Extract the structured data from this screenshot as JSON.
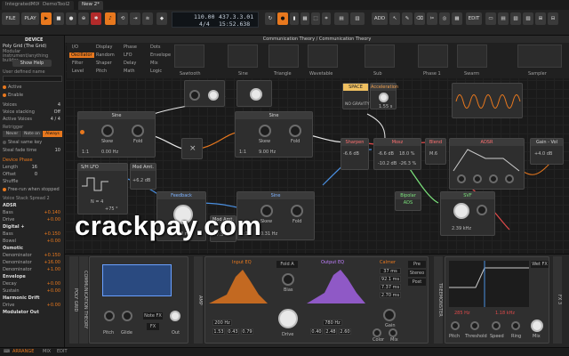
{
  "app": {
    "name": "Integrated MIX"
  },
  "tabs": [
    {
      "label": "IntegratedMIX"
    },
    {
      "label": "DemoTool2"
    },
    {
      "label": "New 2*"
    }
  ],
  "toolbar": {
    "file": "FILE",
    "play": "PLAY",
    "add": "ADD",
    "edit": "EDIT"
  },
  "transport": {
    "tempo": "110.00",
    "signature": "4/4",
    "position": "437.3.3.01",
    "time": "15:52.638"
  },
  "device": {
    "header": "DEVICE",
    "name": "Poly Grid (The Grid)",
    "description": "Modular instrument/anything builder",
    "show_help": "Show Help",
    "user_label": "User defined name",
    "active_label": "Active",
    "enable_label": "Enable",
    "voices_label": "Voices",
    "voices_value": "4",
    "voice_stacking_label": "Voice stacking",
    "voice_stacking_value": "Off",
    "active_voices_label": "Active Voices",
    "active_voices_value": "4 / 4",
    "retrigger_label": "Retrigger",
    "retrigger_opts": [
      "Never",
      "Note on",
      "Always"
    ],
    "steal_label": "Steal same key",
    "steal_fade_label": "Steal fade time",
    "steal_fade_value": "10",
    "phase_header": "Device Phase",
    "length_label": "Length",
    "length_value": "16",
    "offset_label": "Offset",
    "offset_value": "0",
    "shuffle_label": "Shuffle",
    "free_run_label": "Free-run when stopped",
    "spread_label": "Voice Stack Spread 2",
    "adsr_label": "ADSR",
    "params": [
      {
        "name": "Bass",
        "value": "+0.140"
      },
      {
        "name": "Drive",
        "value": "+0.00"
      },
      {
        "name": "Digital +",
        "value": ""
      },
      {
        "name": "Bass",
        "value": "+0.150"
      },
      {
        "name": "Bowel",
        "value": "+0.00"
      },
      {
        "name": "Osmotic",
        "value": ""
      },
      {
        "name": "Denominator",
        "value": "+0.150"
      },
      {
        "name": "Denominator",
        "value": "+16.00"
      },
      {
        "name": "Denominator",
        "value": "+1.00"
      },
      {
        "name": "Envelope",
        "value": ""
      },
      {
        "name": "Decay",
        "value": "+0.00"
      },
      {
        "name": "Sustain",
        "value": "+0.00"
      },
      {
        "name": "Harmonic Drift",
        "value": ""
      },
      {
        "name": "Drive",
        "value": "+0.00"
      },
      {
        "name": "Modulator Out",
        "value": ""
      }
    ]
  },
  "browser": {
    "cols": [
      [
        "I/O",
        "Oscillator",
        "Filter",
        "Level"
      ],
      [
        "Display",
        "Random",
        "Shaper",
        "Pitch"
      ],
      [
        "Phase",
        "LFO",
        "Delay",
        "Math"
      ],
      [
        "Dots",
        "Envelope",
        "Mix",
        "Logic"
      ]
    ],
    "thumbs": [
      "Sawtooth",
      "Sine",
      "Triangle",
      "Wavetable",
      "Sub",
      "Phase 1",
      "Swarm",
      "Sampler"
    ]
  },
  "canvas": {
    "title": "Communication Theory / Communication Theory",
    "modules": {
      "sine1": "Sine",
      "sine2": "Sine",
      "sine3": "Sine",
      "shlfo": "S/H LFO",
      "modamt1": "Mod Amt.",
      "modamt2": "Mod Amt.",
      "feedback": "Feedback",
      "space": "SPACE",
      "no_gravity": "NO GRAVITY",
      "acceleration": "Acceleration",
      "sharpen": "Sharpen",
      "mosz": "Mosz",
      "blend": "Blend",
      "adsr": "ADSR",
      "gain_vol": "Gain - Vol",
      "svf": "SVF",
      "bipolar": "Bipolar ADS"
    },
    "values": {
      "skew": "Skew",
      "fold": "Fold",
      "ratio1": "1:1",
      "hz1": "0.00 Hz",
      "ratio2": "1:1",
      "hz2": "9.00 Hz",
      "ratio3": "1:1",
      "hz3": "0.31 Hz",
      "modamt_val": "+6.2 dB",
      "modamt_val2": "+7.3 dB",
      "feedback_val": "24.0 ms",
      "accel_val": "1.55 s",
      "sharpen_val": "-6.6 dB",
      "mosz_val": "18.0 %",
      "blend_val": "M.6",
      "gain_val": "+4.0 dB",
      "svf_val": "2.39 kHz",
      "n_val": "N = 4",
      "pct_val": "+75 °",
      "sharpen_val2": "-10.2 dB",
      "mosz_val2": "-26.3 %"
    }
  },
  "chain": {
    "poly_grid": "POLY GRID",
    "comm_theory": "COMMUNICATION THEORY",
    "amp": "AMP",
    "note_fx": "Note FX",
    "fx": "FX",
    "pitch": "Pitch",
    "glide": "Glide",
    "out": "Out",
    "input_eq": "Input EQ",
    "output_eq": "Output EQ",
    "fold_a": "Fold A",
    "bias": "Bias",
    "drive": "Drive",
    "calmer": "Calmer",
    "gain": "Gain",
    "color": "Color",
    "mix": "Mix",
    "pre": "Pre",
    "stereo": "Stereo",
    "post": "Post",
    "input_vals": [
      "200 Hz",
      "780 Hz",
      "1.53",
      "0.43",
      "0.79",
      "0.40",
      "2.48",
      "2.60"
    ],
    "calmer_vals": [
      "37 ms",
      "92.1 ms",
      "7.37 ms",
      "2.70 ms"
    ],
    "treemonster": "TREEMONSTER",
    "treemonster_vals": [
      "285 Hz",
      "1.18 kHz"
    ],
    "wet_fx": "Wet FX",
    "tm_knobs": [
      "Pitch",
      "Threshold",
      "Speed",
      "Ring",
      "Mix"
    ],
    "fx_strip": "FX 3"
  },
  "bottombar": {
    "arrange": "ARRANGE",
    "mix": "MIX",
    "edit": "EDIT"
  },
  "watermark": "crackpay.com",
  "colors": {
    "accent": "#e8781e",
    "background": "#141414",
    "panel": "#242424"
  }
}
